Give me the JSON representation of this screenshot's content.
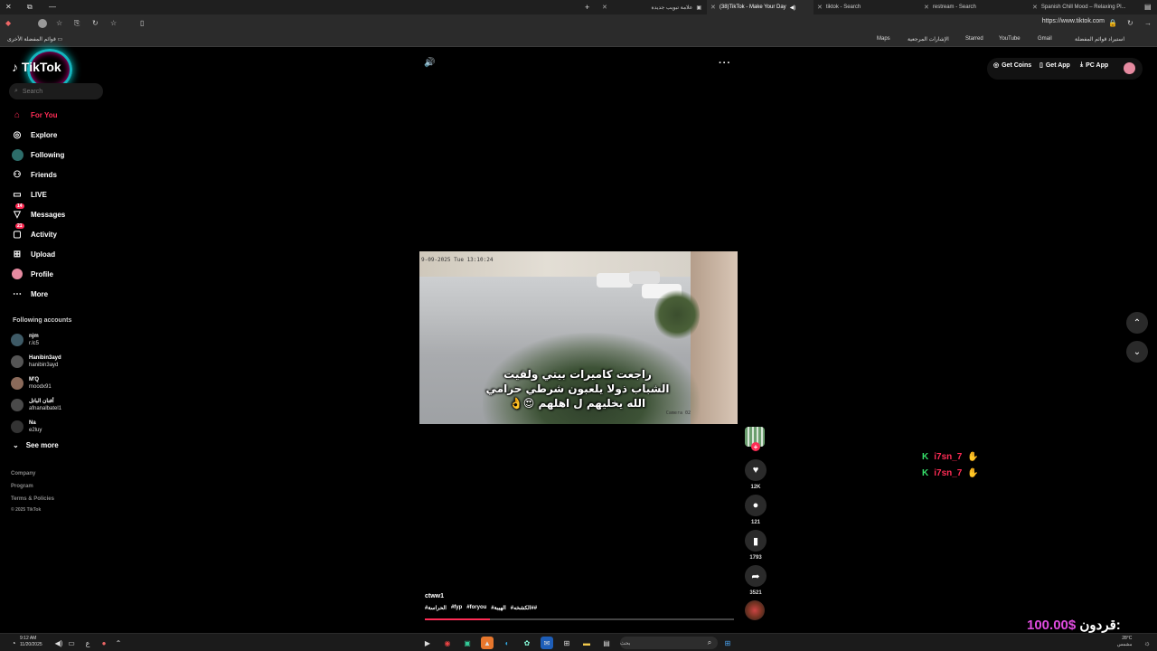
{
  "browser": {
    "tabs": [
      {
        "title": "علامة تبويب جديدة",
        "active": false
      },
      {
        "title": "(38)TikTok - Make Your Day",
        "active": true
      },
      {
        "title": "tiktok - Search",
        "active": false
      },
      {
        "title": "restream - Search",
        "active": false
      },
      {
        "title": "Spanish Chill Mood – Relaxing Pl...",
        "active": false
      }
    ],
    "url": "https://www.tiktok.com",
    "bookmarks": [
      "Maps",
      "الإشارات المرجعية",
      "Starred",
      "YouTube",
      "Gmail",
      "استيراد قوائم المفضلة"
    ],
    "other_bookmarks": "قوائم المفضلة الأخرى"
  },
  "sidebar": {
    "logo": "TikTok",
    "search_placeholder": "Search",
    "nav": [
      {
        "label": "For You",
        "icon": "home-icon",
        "active": true
      },
      {
        "label": "Explore",
        "icon": "compass-icon"
      },
      {
        "label": "Following",
        "icon": "following-avatar-icon"
      },
      {
        "label": "Friends",
        "icon": "friends-icon"
      },
      {
        "label": "LIVE",
        "icon": "live-icon"
      },
      {
        "label": "Messages",
        "icon": "messages-icon",
        "badge": "14"
      },
      {
        "label": "Activity",
        "icon": "activity-icon",
        "badge": "21"
      },
      {
        "label": "Upload",
        "icon": "upload-icon"
      },
      {
        "label": "Profile",
        "icon": "profile-icon"
      },
      {
        "label": "More",
        "icon": "more-icon"
      }
    ],
    "following_title": "Following accounts",
    "accounts": [
      {
        "name": "njm",
        "handle": "r.lc5"
      },
      {
        "name": "Hanibin3ayd",
        "handle": "hanibin3ayd"
      },
      {
        "name": "M'Q",
        "handle": "moodx91"
      },
      {
        "name": "أفنان الباتل",
        "handle": "afnanalbatel1"
      },
      {
        "name": "Na",
        "handle": "e2luy"
      }
    ],
    "see_more": "See more",
    "footer": [
      "Company",
      "Program",
      "Terms & Policies",
      "© 2025 TikTok"
    ]
  },
  "topbar": {
    "get_coins": "Get Coins",
    "get_app": "Get App",
    "pc_app": "PC App"
  },
  "video": {
    "timestamp": "9-09-2025 Tue 13:10:24",
    "camera_label": "Camera 02",
    "caption_lines": [
      "راجعت كاميرات بيتي ولقيت",
      "الشباب ذولا يلعبون شرطي حرامي",
      "الله يخليهم ل اهلهم 😍👌"
    ],
    "author": "ctww1",
    "hashtags": [
      "#الحراسة",
      "#fyp",
      "#foryou",
      "#الهيبة",
      "#الكشخه##"
    ],
    "progress": 0.21
  },
  "actions": {
    "likes": "12K",
    "comments": "121",
    "saves": "1793",
    "shares": "3521"
  },
  "chat": [
    {
      "user": "i7sn_7"
    },
    {
      "user": "i7sn_7"
    }
  ],
  "donation": {
    "label": "قردون:",
    "amount": "100.00$"
  },
  "taskbar": {
    "time": "9:12 AM",
    "date": "11/20/2025",
    "search_placeholder": "بحث",
    "weather_temp": "28°C",
    "weather_desc": "مشمس"
  },
  "colors": {
    "accent": "#fe2c55",
    "chat_k": "#36e06a",
    "donation": "#e04ce0"
  }
}
